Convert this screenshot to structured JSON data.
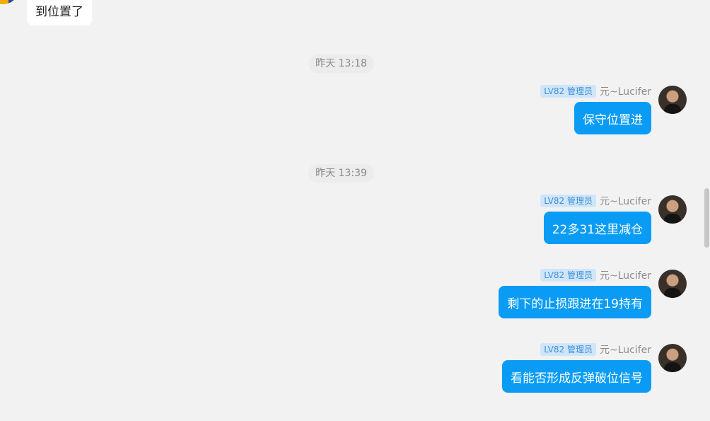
{
  "incoming": {
    "text": "到位置了"
  },
  "timestamps": [
    "昨天 13:18",
    "昨天 13:39"
  ],
  "sender": {
    "level_badge": "LV82 管理员",
    "name": "元~Lucifer"
  },
  "messages": [
    {
      "text": "保守位置进"
    },
    {
      "text": "22多31这里减仓"
    },
    {
      "text": "剩下的止损跟进在19持有"
    },
    {
      "text": "看能否形成反弹破位信号"
    }
  ],
  "colors": {
    "outgoing_bubble": "#0a9cf5",
    "background": "#f2f2f2",
    "badge_bg": "#cfe6fa"
  }
}
